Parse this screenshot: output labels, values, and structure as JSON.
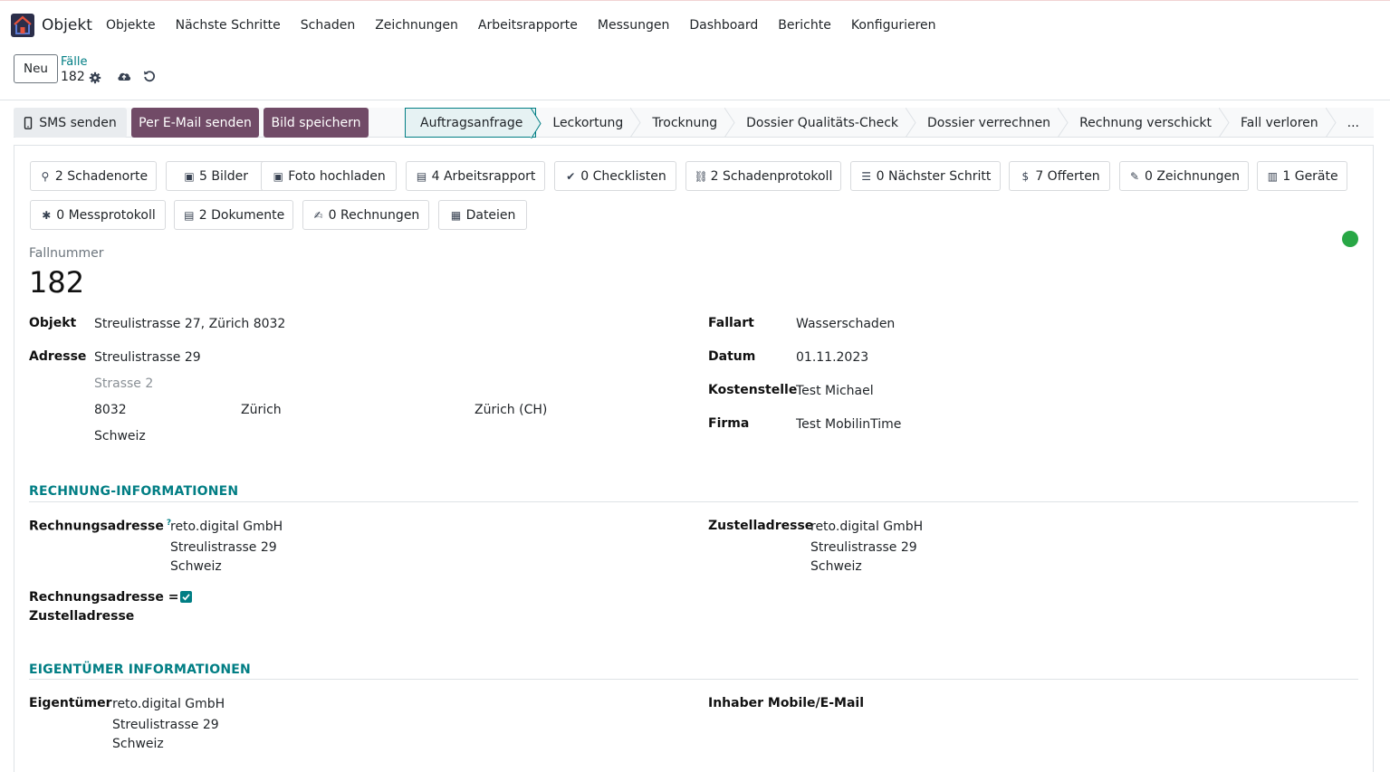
{
  "app": {
    "name": "Objekt",
    "menu": [
      "Objekte",
      "Nächste Schritte",
      "Schaden",
      "Zeichnungen",
      "Arbeitsrapporte",
      "Messungen",
      "Dashboard",
      "Berichte",
      "Konfigurieren"
    ]
  },
  "control": {
    "new_label": "Neu",
    "breadcrumb_parent": "Fälle",
    "breadcrumb_current": "182"
  },
  "header_buttons": {
    "sms": "SMS senden",
    "email": "Per E-Mail senden",
    "save_image": "Bild speichern"
  },
  "stages": [
    "Auftragsanfrage",
    "Leckortung",
    "Trocknung",
    "Dossier Qualitäts-Check",
    "Dossier verrechnen",
    "Rechnung verschickt",
    "Fall verloren",
    "..."
  ],
  "active_stage": "Auftragsanfrage",
  "smart_buttons": [
    {
      "label": "2 Schadenorte",
      "icon": "map-marker-icon"
    },
    {
      "label": "5 Bilder",
      "icon": "image-icon"
    },
    {
      "label": "Foto hochladen",
      "icon": "image-icon"
    },
    {
      "label": "4 Arbeitsrapport",
      "icon": "file-icon"
    },
    {
      "label": "0 Checklisten",
      "icon": "check-icon"
    },
    {
      "label": "2 Schadenprotokoll",
      "icon": "chain-icon"
    },
    {
      "label": "0 Nächster Schritt",
      "icon": "list-icon"
    },
    {
      "label": "7 Offerten",
      "icon": "dollar-icon"
    },
    {
      "label": "0 Zeichnungen",
      "icon": "pencil-icon"
    },
    {
      "label": "1 Geräte",
      "icon": "building-icon"
    },
    {
      "label": "0 Messprotokoll",
      "icon": "asterisk-icon"
    },
    {
      "label": "2 Dokumente",
      "icon": "file-icon"
    },
    {
      "label": "0 Rechnungen",
      "icon": "edit-icon"
    },
    {
      "label": "Dateien",
      "icon": "excel-file-icon"
    }
  ],
  "status_color": "#28a745",
  "record": {
    "fallnummer_label": "Fallnummer",
    "fallnummer": "182",
    "objekt_label": "Objekt",
    "objekt": "Streulistrasse 27, Zürich 8032",
    "adresse_label": "Adresse",
    "street": "Streulistrasse 29",
    "street2_placeholder": "Strasse 2",
    "zip": "8032",
    "city": "Zürich",
    "state": "Zürich (CH)",
    "country": "Schweiz",
    "fallart_label": "Fallart",
    "fallart": "Wasserschaden",
    "datum_label": "Datum",
    "datum": "01.11.2023",
    "kostenstelle_label": "Kostenstelle",
    "kostenstelle": "Test Michael",
    "firma_label": "Firma",
    "firma": "Test MobilinTime"
  },
  "rechnung": {
    "title": "RECHNUNG-INFORMATIONEN",
    "rechnungsadresse_label": "Rechnungsadresse",
    "help_mark": "?",
    "rechnungsadresse": [
      "reto.digital GmbH",
      "Streulistrasse 29",
      "Schweiz"
    ],
    "zustelladresse_label": "Zustelladresse",
    "zustelladresse": [
      "reto.digital GmbH",
      "Streulistrasse 29",
      "Schweiz"
    ],
    "same_label_1": "Rechnungsadresse =",
    "same_label_2": "Zustelladresse",
    "same_checked": true
  },
  "eigentuemer": {
    "title": "EIGENTÜMER INFORMATIONEN",
    "eigentuemer_label": "Eigentümer",
    "eigentuemer": [
      "reto.digital GmbH",
      "Streulistrasse 29",
      "Schweiz"
    ],
    "inhaber_label": "Inhaber Mobile/E-Mail"
  }
}
